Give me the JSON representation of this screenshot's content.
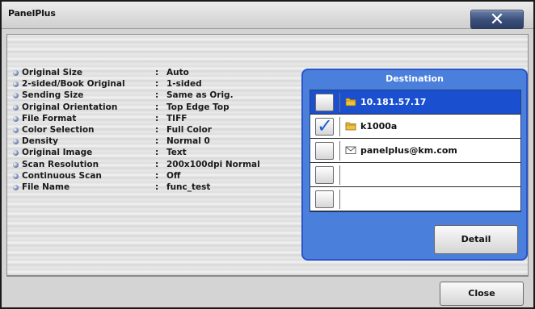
{
  "window": {
    "title": "PanelPlus",
    "close_glyph": "✕"
  },
  "properties": [
    {
      "label": "Original Size",
      "value": "Auto"
    },
    {
      "label": "2-sided/Book Original",
      "value": "1-sided"
    },
    {
      "label": "Sending Size",
      "value": "Same as Orig."
    },
    {
      "label": "Original Orientation",
      "value": "Top Edge Top"
    },
    {
      "label": "File Format",
      "value": "TIFF"
    },
    {
      "label": "Color Selection",
      "value": "Full Color"
    },
    {
      "label": "Density",
      "value": "Normal 0"
    },
    {
      "label": "Original Image",
      "value": "Text"
    },
    {
      "label": "Scan Resolution",
      "value": "200x100dpi Normal"
    },
    {
      "label": "Continuous Scan",
      "value": "Off"
    },
    {
      "label": "File Name",
      "value": "func_test"
    }
  ],
  "property_separator": ":",
  "destination": {
    "header": "Destination",
    "rows": [
      {
        "text": "10.181.57.17",
        "icon": "folder-icon",
        "checked": false,
        "selected": true
      },
      {
        "text": "k1000a",
        "icon": "folder-icon",
        "checked": true,
        "selected": false
      },
      {
        "text": "panelplus@km.com",
        "icon": "mail-icon",
        "checked": false,
        "selected": false
      },
      {
        "text": "",
        "icon": "",
        "checked": false,
        "selected": false
      },
      {
        "text": "",
        "icon": "",
        "checked": false,
        "selected": false
      }
    ],
    "detail_label": "Detail",
    "check_glyph": "✓"
  },
  "footer": {
    "close_label": "Close"
  },
  "colors": {
    "panel_blue": "#4b7fdc",
    "selected_row": "#1a4fd0",
    "check_blue": "#1f5fd8"
  }
}
